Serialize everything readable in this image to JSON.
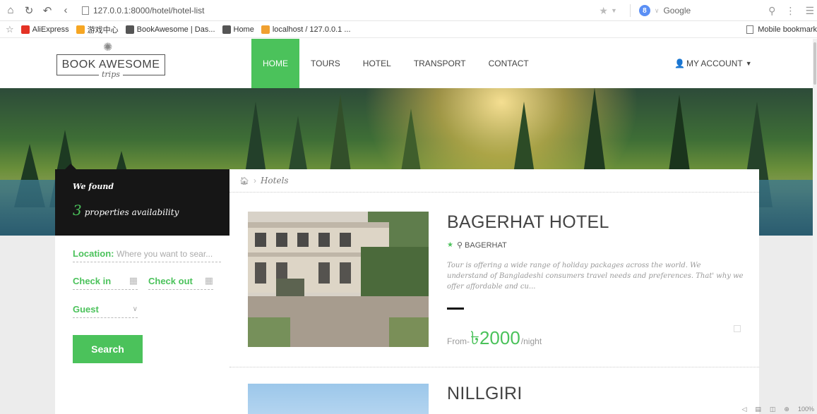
{
  "browser": {
    "url": "127.0.0.1:8000/hotel/hotel-list",
    "search_engine": "Google",
    "bookmarks": [
      {
        "label": "AliExpress",
        "color": "#e43225"
      },
      {
        "label": "游戏中心",
        "color": "#f6a623"
      },
      {
        "label": "BookAwesome | Das...",
        "color": "#555555"
      },
      {
        "label": "Home",
        "color": "#555555"
      },
      {
        "label": "localhost / 127.0.0.1 ...",
        "color": "#f0a030"
      }
    ],
    "mobile_bookmarks": "Mobile bookmark",
    "zoom": "100%"
  },
  "site": {
    "logo": {
      "text": "BOOK AWESOME",
      "tagline": "trips"
    },
    "menu": [
      {
        "label": "HOME",
        "active": true
      },
      {
        "label": "TOURS",
        "active": false
      },
      {
        "label": "HOTEL",
        "active": false
      },
      {
        "label": "TRANSPORT",
        "active": false
      },
      {
        "label": "CONTACT",
        "active": false
      }
    ],
    "account": "MY ACCOUNT",
    "accent_color": "#4bc25b"
  },
  "sidebar": {
    "we_found": "We found",
    "count": "3",
    "count_label": "properties availability",
    "location_label": "Location:",
    "location_placeholder": "Where you want to sear...",
    "check_in": "Check in",
    "check_out": "Check out",
    "guest": "Guest",
    "search_button": "Search"
  },
  "breadcrumb": {
    "current": "Hotels"
  },
  "hotels": [
    {
      "name": "BAGERHAT HOTEL",
      "location": "BAGERHAT",
      "description": "Tour is offering a wide range of holiday packages across the world. We understand of Bangladeshi consumers travel needs and preferences. That' why we offer affordable and cu...",
      "price_prefix": "From-",
      "price": "৳2000",
      "price_suffix": "/night"
    },
    {
      "name": "NILLGIRI"
    }
  ]
}
